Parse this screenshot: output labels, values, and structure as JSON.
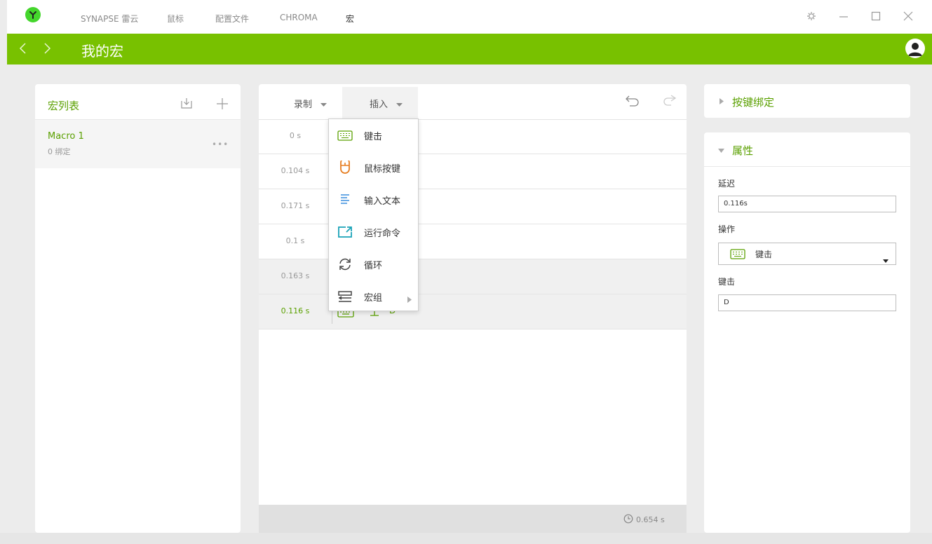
{
  "nav": {
    "items": [
      "SYNAPSE 雷云",
      "鼠标",
      "配置文件",
      "CHROMA",
      "宏"
    ]
  },
  "header": {
    "title": "我的宏"
  },
  "macro_list": {
    "title": "宏列表",
    "items": [
      {
        "name": "Macro 1",
        "binding": "0 绑定"
      }
    ]
  },
  "editor": {
    "record_label": "录制",
    "insert_label": "插入",
    "rows": [
      {
        "time": "0 s"
      },
      {
        "time": "0.104 s"
      },
      {
        "time": "0.171 s"
      },
      {
        "time": "0.1 s"
      },
      {
        "time": "0.163 s"
      },
      {
        "time": "0.116 s",
        "key": "D"
      }
    ],
    "total_time": "0.654 s"
  },
  "insert_menu": {
    "items": [
      {
        "label": "键击",
        "icon": "keyboard-icon"
      },
      {
        "label": "鼠标按键",
        "icon": "mouse-icon"
      },
      {
        "label": "输入文本",
        "icon": "text-icon"
      },
      {
        "label": "运行命令",
        "icon": "run-command-icon"
      },
      {
        "label": "循环",
        "icon": "loop-icon"
      },
      {
        "label": "宏组",
        "icon": "macro-group-icon"
      }
    ]
  },
  "key_binding": {
    "title": "按键绑定"
  },
  "properties": {
    "title": "属性",
    "delay_label": "延迟",
    "delay_value": "0.116s",
    "action_label": "操作",
    "action_value": "键击",
    "keystroke_label": "键击",
    "keystroke_value": "D"
  },
  "colors": {
    "accent": "#78c100",
    "accent_text": "#5aa000"
  }
}
